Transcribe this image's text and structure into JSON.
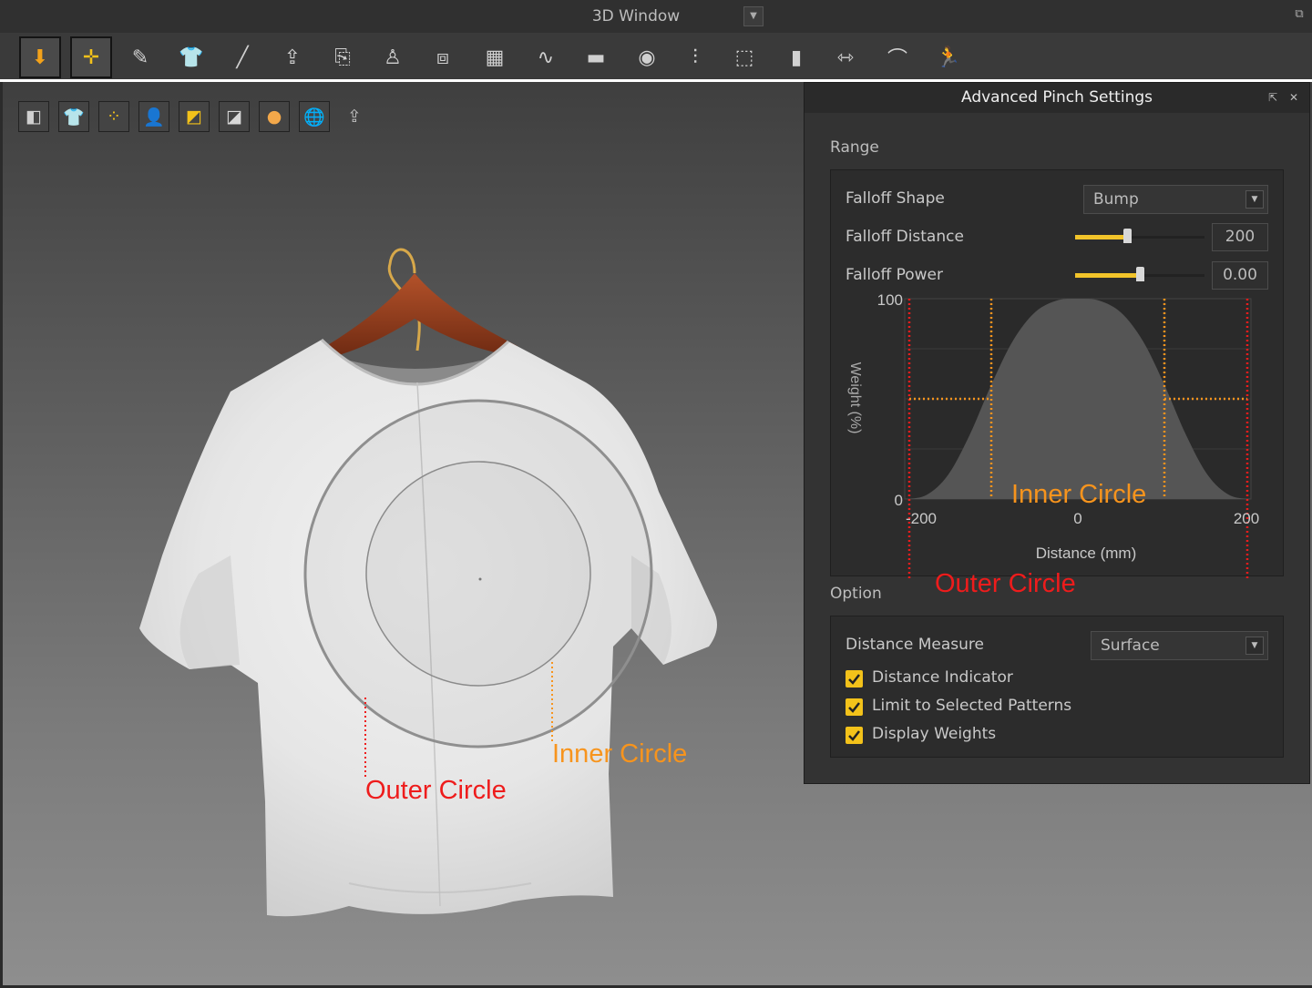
{
  "window": {
    "title": "3D Window",
    "menu_arrow": "▼",
    "popout_icon": "popout-icon"
  },
  "toolbar": {
    "tools": [
      {
        "name": "arrow-down-icon",
        "selected": true
      },
      {
        "name": "move-cursor-icon",
        "selected": true
      },
      {
        "name": "brush-icon",
        "selected": false
      },
      {
        "name": "garment-select-icon",
        "selected": false
      },
      {
        "name": "needle-icon",
        "selected": false
      },
      {
        "name": "fold-icon",
        "selected": false
      },
      {
        "name": "arrange-icon",
        "selected": false
      },
      {
        "name": "avatar-pin-icon",
        "selected": false
      },
      {
        "name": "pin-box-icon",
        "selected": false
      },
      {
        "name": "grid-icon",
        "selected": false
      },
      {
        "name": "tuck-icon",
        "selected": false
      },
      {
        "name": "tape-icon",
        "selected": false
      },
      {
        "name": "button-icon",
        "selected": false
      },
      {
        "name": "zipper-icon",
        "selected": false
      },
      {
        "name": "piping-icon",
        "selected": false
      },
      {
        "name": "block-icon",
        "selected": false
      },
      {
        "name": "pinch-icon",
        "selected": false
      },
      {
        "name": "measure-icon",
        "selected": false
      },
      {
        "name": "avatar-walk-icon",
        "selected": false
      }
    ]
  },
  "viewport": {
    "tools": [
      "fabric-solid-icon",
      "garment-view-icon",
      "pattern-points-icon",
      "avatar-view-icon",
      "texture-icon",
      "thickness-icon",
      "skin-icon",
      "wireframe-globe-icon",
      "export-icon"
    ],
    "annotations": {
      "outer_circle": "Outer Circle",
      "inner_circle": "Inner Circle"
    }
  },
  "colors": {
    "accent_yellow": "#f3c21a",
    "annotation_red": "#ee1c1c",
    "annotation_orange": "#f7941d"
  },
  "panel": {
    "title": "Advanced Pinch Settings",
    "range_label": "Range",
    "falloff_shape": {
      "label": "Falloff Shape",
      "value": "Bump"
    },
    "falloff_distance": {
      "label": "Falloff Distance",
      "value": "200",
      "slider_fraction": 0.4
    },
    "falloff_power": {
      "label": "Falloff Power",
      "value": "0.00",
      "slider_fraction": 0.5
    },
    "chart": {
      "y_top": "100",
      "y_bottom": "0",
      "ylabel": "Weight (%)",
      "x_ticks": [
        "-200",
        "0",
        "200"
      ],
      "xlabel": "Distance (mm)",
      "inner_circle": "Inner Circle",
      "outer_circle": "Outer Circle"
    },
    "option_label": "Option",
    "distance_measure": {
      "label": "Distance Measure",
      "value": "Surface"
    },
    "checkboxes": [
      {
        "label": "Distance Indicator",
        "checked": true
      },
      {
        "label": "Limit to Selected Patterns",
        "checked": true
      },
      {
        "label": "Display Weights",
        "checked": true
      }
    ]
  },
  "chart_data": {
    "type": "area",
    "title": "",
    "xlabel": "Distance (mm)",
    "ylabel": "Weight (%)",
    "xlim": [
      -200,
      200
    ],
    "ylim": [
      0,
      100
    ],
    "x": [
      -200,
      -175,
      -150,
      -125,
      -100,
      -75,
      -50,
      -25,
      0,
      25,
      50,
      75,
      100,
      125,
      150,
      175,
      200
    ],
    "series": [
      {
        "values": [
          0,
          2,
          12,
          32,
          57,
          79,
          93,
          99,
          100,
          99,
          93,
          79,
          57,
          32,
          12,
          2,
          0
        ]
      }
    ],
    "markers": {
      "outer_circle_x": [
        -200,
        200
      ],
      "inner_circle_x": [
        -100,
        100
      ],
      "inner_circle_weight": 50
    },
    "grid": true
  }
}
